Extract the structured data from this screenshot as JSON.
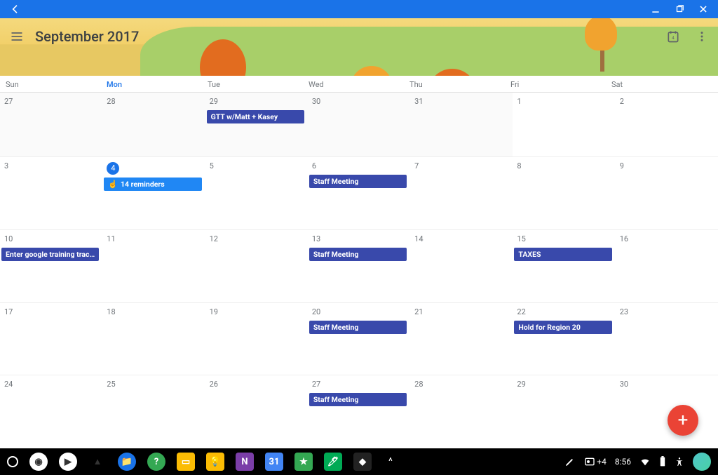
{
  "titlebar": {
    "back_icon": "arrow-left",
    "minimize_icon": "minimize",
    "restore_icon": "restore",
    "close_icon": "close"
  },
  "header": {
    "title": "September 2017",
    "menu_icon": "hamburger",
    "today_icon": "calendar-today",
    "overflow_icon": "more-vert"
  },
  "days_of_week": [
    "Sun",
    "Mon",
    "Tue",
    "Wed",
    "Thu",
    "Fri",
    "Sat"
  ],
  "highlight_dow_index": 1,
  "today_date": 4,
  "weeks": [
    {
      "prev": true,
      "days": [
        {
          "n": "27",
          "prev": true
        },
        {
          "n": "28",
          "prev": true
        },
        {
          "n": "29",
          "prev": true,
          "events": [
            {
              "title": "GTT w/Matt + Kasey"
            }
          ]
        },
        {
          "n": "30",
          "prev": true
        },
        {
          "n": "31",
          "prev": true
        },
        {
          "n": "1"
        },
        {
          "n": "2"
        }
      ]
    },
    {
      "days": [
        {
          "n": "3"
        },
        {
          "n": "4",
          "today": true,
          "events": [
            {
              "title": "14 reminders",
              "reminder": true
            }
          ]
        },
        {
          "n": "5"
        },
        {
          "n": "6",
          "events": [
            {
              "title": "Staff Meeting"
            }
          ]
        },
        {
          "n": "7"
        },
        {
          "n": "8"
        },
        {
          "n": "9"
        }
      ]
    },
    {
      "days": [
        {
          "n": "10",
          "events": [
            {
              "title": "Enter google training tracking info"
            }
          ]
        },
        {
          "n": "11"
        },
        {
          "n": "12"
        },
        {
          "n": "13",
          "events": [
            {
              "title": "Staff Meeting"
            }
          ]
        },
        {
          "n": "14"
        },
        {
          "n": "15",
          "events": [
            {
              "title": "TAXES"
            }
          ]
        },
        {
          "n": "16"
        }
      ]
    },
    {
      "days": [
        {
          "n": "17"
        },
        {
          "n": "18"
        },
        {
          "n": "19"
        },
        {
          "n": "20",
          "events": [
            {
              "title": "Staff Meeting"
            }
          ]
        },
        {
          "n": "21"
        },
        {
          "n": "22",
          "events": [
            {
              "title": "Hold for Region 20"
            }
          ]
        },
        {
          "n": "23"
        }
      ]
    },
    {
      "days": [
        {
          "n": "24"
        },
        {
          "n": "25"
        },
        {
          "n": "26"
        },
        {
          "n": "27",
          "events": [
            {
              "title": "Staff Meeting"
            }
          ]
        },
        {
          "n": "28"
        },
        {
          "n": "29"
        },
        {
          "n": "30"
        }
      ]
    }
  ],
  "fab": {
    "plus": "+"
  },
  "taskbar": {
    "launcher_icon": "circle-outline",
    "apps": [
      {
        "name": "chrome",
        "bg": "#fff"
      },
      {
        "name": "play",
        "bg": "#fff"
      },
      {
        "name": "drive",
        "bg": "transparent"
      },
      {
        "name": "files",
        "bg": "#1a73e8"
      },
      {
        "name": "help",
        "bg": "#34a853"
      },
      {
        "name": "classroom",
        "bg": "#fbbc04"
      },
      {
        "name": "keep",
        "bg": "#fbbc04"
      },
      {
        "name": "onenote",
        "bg": "#7b3ea8"
      },
      {
        "name": "calendar",
        "bg": "#4285f4"
      },
      {
        "name": "evernote",
        "bg": "#34a853"
      },
      {
        "name": "pen",
        "bg": "#0a5"
      },
      {
        "name": "app",
        "bg": "#222"
      }
    ],
    "overflow_icon": "^",
    "right": {
      "pen_icon": "pen",
      "notif_icon": "image",
      "notif_count": "+4",
      "time": "8:56",
      "wifi_icon": "wifi",
      "battery_icon": "battery",
      "a11y_icon": "accessibility"
    }
  },
  "colors": {
    "primary": "#1a73e8",
    "event": "#3949ab",
    "reminder": "#2087f4",
    "fab": "#ea4335"
  }
}
